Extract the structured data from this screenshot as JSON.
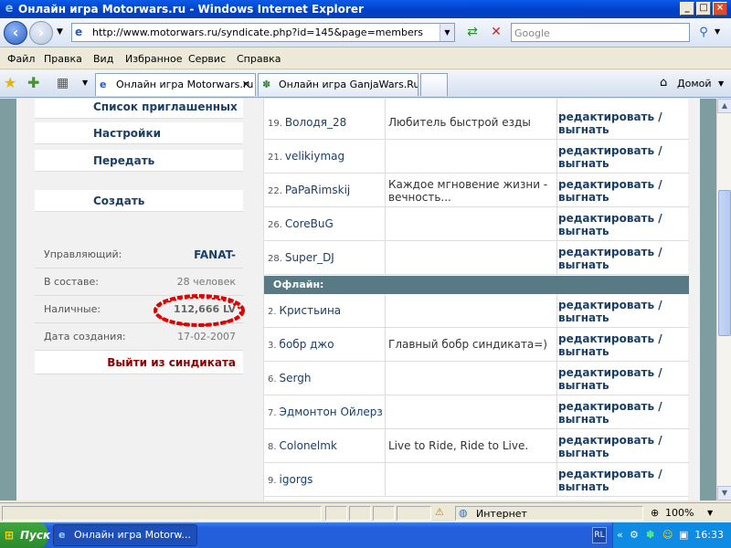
{
  "window": {
    "title": "Онлайн игра Motorwars.ru - Windows Internet Explorer"
  },
  "address": {
    "url": "http://www.motorwars.ru/syndicate.php?id=145&page=members",
    "search_placeholder": "Google"
  },
  "menu": [
    "Файл",
    "Правка",
    "Вид",
    "Избранное",
    "Сервис",
    "Справка"
  ],
  "tabs": [
    {
      "label": "Онлайн игра Motorwars.ru"
    },
    {
      "label": "Онлайн игра GanjaWars.Ru..."
    }
  ],
  "home_label": "Домой",
  "sidebar": {
    "buttons": [
      "Список приглашенных",
      "Настройки",
      "Передать",
      "Создать"
    ],
    "info": [
      {
        "label": "Управляющий:",
        "value": "FANAT-"
      },
      {
        "label": "В составе:",
        "value": "28 человек"
      },
      {
        "label": "Наличные:",
        "value": "112,666 LV"
      },
      {
        "label": "Дата создания:",
        "value": "17-02-2007"
      }
    ],
    "leave": "Выйти из синдиката"
  },
  "members_online": [
    {
      "num": "19.",
      "name": "Володя_28",
      "status": "Любитель быстрой езды"
    },
    {
      "num": "21.",
      "name": "velikiymag",
      "status": ""
    },
    {
      "num": "22.",
      "name": "PaPaRimskij",
      "status": "Каждое мгновение жизни - вечность..."
    },
    {
      "num": "26.",
      "name": "CoreBuG",
      "status": ""
    },
    {
      "num": "28.",
      "name": "Super_DJ",
      "status": ""
    }
  ],
  "offline_header": "Офлайн:",
  "members_offline": [
    {
      "num": "2.",
      "name": "Кристьина",
      "status": ""
    },
    {
      "num": "3.",
      "name": "бобр джо",
      "status": "Главный бобр синдиката=)"
    },
    {
      "num": "6.",
      "name": "Sergh",
      "status": ""
    },
    {
      "num": "7.",
      "name": "Эдмонтон Ойлерз",
      "status": ""
    },
    {
      "num": "8.",
      "name": "Colonelmk",
      "status": "Live to Ride, Ride to Live."
    },
    {
      "num": "9.",
      "name": "igorgs",
      "status": ""
    }
  ],
  "actions": {
    "edit": "редактировать",
    "sep": "/",
    "kick": "выгнать"
  },
  "status": {
    "zone": "Интернет",
    "zoom": "100%"
  },
  "taskbar": {
    "start": "Пуск",
    "item": "Онлайн игра Motorw...",
    "lang": "RL",
    "clock": "16:33"
  },
  "colors": {
    "title_blue": "#0A5AE8",
    "link_blue": "#1B3F66",
    "offline_header": "#587A85",
    "leave_red": "#8B0000",
    "circle_red": "#E00000"
  }
}
